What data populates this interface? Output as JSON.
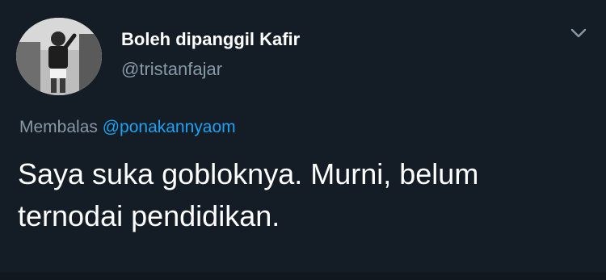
{
  "tweet": {
    "author": {
      "display_name": "Boleh dipanggil Kafir",
      "handle": "@tristanfajar"
    },
    "reply_to": {
      "prefix": "Membalas",
      "mention": "@ponakannyaom"
    },
    "text": "Saya suka gobloknya. Murni, belum ternodai pendidikan."
  },
  "icons": {
    "menu": "chevron-down-icon",
    "avatar": "avatar"
  },
  "colors": {
    "background": "#141d26",
    "text_primary": "#ffffff",
    "text_secondary": "#8899a6",
    "link": "#1da1f2"
  }
}
